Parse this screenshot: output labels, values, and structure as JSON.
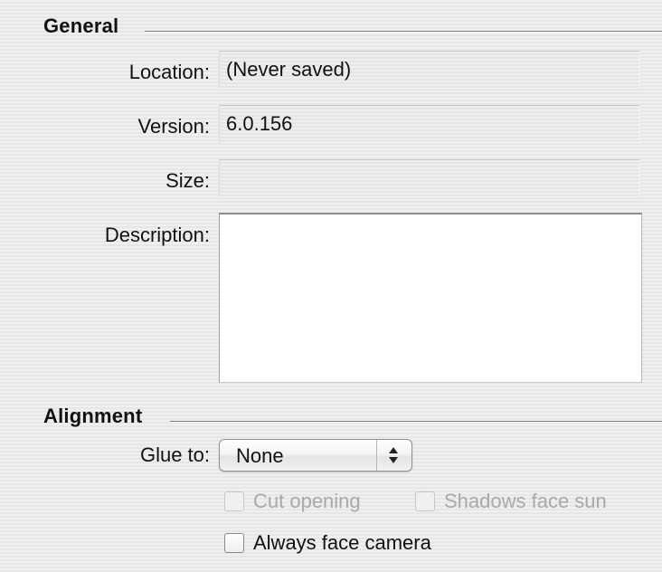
{
  "general": {
    "title": "General",
    "location": {
      "label": "Location:",
      "value": "(Never saved)"
    },
    "version": {
      "label": "Version:",
      "value": "6.0.156"
    },
    "size": {
      "label": "Size:",
      "value": ""
    },
    "description": {
      "label": "Description:",
      "value": ""
    }
  },
  "alignment": {
    "title": "Alignment",
    "glue_to": {
      "label": "Glue to:",
      "selected": "None",
      "stepper_icon": "up-down-arrows-icon"
    },
    "checkboxes": {
      "cut_opening": {
        "label": "Cut opening",
        "checked": false,
        "enabled": false
      },
      "shadows_face_sun": {
        "label": "Shadows face sun",
        "checked": false,
        "enabled": false
      },
      "always_face_camera": {
        "label": "Always face camera",
        "checked": false,
        "enabled": true
      }
    }
  },
  "colors": {
    "panel_background": "#ececec",
    "disabled_text": "#a9a9a9"
  }
}
